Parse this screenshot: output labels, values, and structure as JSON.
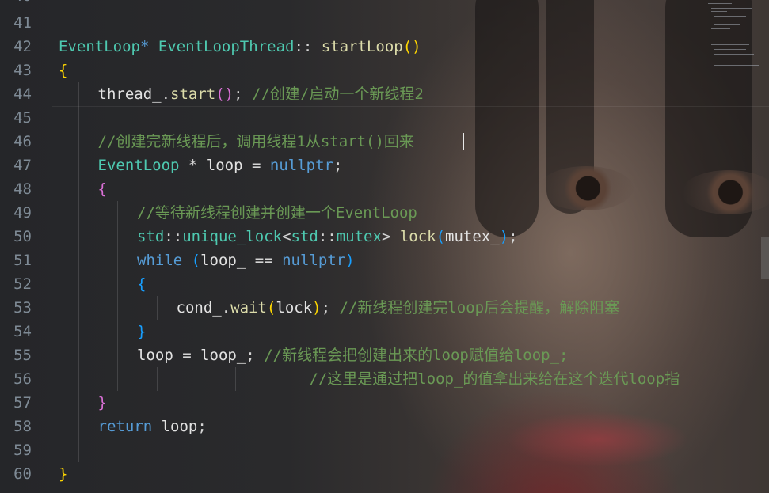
{
  "editor": {
    "first_line_partial": "40",
    "lines": [
      {
        "n": "41",
        "indent": 0,
        "tokens": []
      },
      {
        "n": "42",
        "indent": 0,
        "tokens": [
          [
            "type",
            "EventLoop"
          ],
          [
            "kw",
            "*"
          ],
          [
            "plain",
            " "
          ],
          [
            "type",
            "EventLoopThread"
          ],
          [
            "plain",
            ":: "
          ],
          [
            "fn",
            "startLoop"
          ],
          [
            "b1",
            "()"
          ]
        ]
      },
      {
        "n": "43",
        "indent": 0,
        "tokens": [
          [
            "b1",
            "{"
          ]
        ]
      },
      {
        "n": "44",
        "indent": 1,
        "tokens": [
          [
            "var",
            "thread_"
          ],
          [
            "plain",
            "."
          ],
          [
            "fn",
            "start"
          ],
          [
            "b2",
            "()"
          ],
          [
            "plain",
            "; "
          ],
          [
            "cmt",
            "//创建/启动一个新线程2"
          ]
        ]
      },
      {
        "n": "45",
        "indent": 0,
        "tokens": []
      },
      {
        "n": "46",
        "indent": 1,
        "tokens": [
          [
            "cmt",
            "//创建完新线程后，调用线程1从start()回来"
          ]
        ]
      },
      {
        "n": "47",
        "indent": 1,
        "tokens": [
          [
            "type",
            "EventLoop"
          ],
          [
            "plain",
            " * "
          ],
          [
            "var",
            "loop"
          ],
          [
            "plain",
            " = "
          ],
          [
            "kw",
            "nullptr"
          ],
          [
            "plain",
            ";"
          ]
        ]
      },
      {
        "n": "48",
        "indent": 1,
        "tokens": [
          [
            "b2",
            "{"
          ]
        ]
      },
      {
        "n": "49",
        "indent": 2,
        "tokens": [
          [
            "cmt",
            "//等待新线程创建并创建一个EventLoop"
          ]
        ]
      },
      {
        "n": "50",
        "indent": 2,
        "tokens": [
          [
            "type",
            "std"
          ],
          [
            "plain",
            "::"
          ],
          [
            "type",
            "unique_lock"
          ],
          [
            "plain",
            "<"
          ],
          [
            "type",
            "std"
          ],
          [
            "plain",
            "::"
          ],
          [
            "type",
            "mutex"
          ],
          [
            "plain",
            "> "
          ],
          [
            "fn",
            "lock"
          ],
          [
            "b3",
            "("
          ],
          [
            "var",
            "mutex_"
          ],
          [
            "b3",
            ")"
          ],
          [
            "plain",
            ";"
          ]
        ]
      },
      {
        "n": "51",
        "indent": 2,
        "tokens": [
          [
            "kw",
            "while"
          ],
          [
            "plain",
            " "
          ],
          [
            "b3",
            "("
          ],
          [
            "var",
            "loop_"
          ],
          [
            "plain",
            " == "
          ],
          [
            "kw",
            "nullptr"
          ],
          [
            "b3",
            ")"
          ]
        ]
      },
      {
        "n": "52",
        "indent": 2,
        "tokens": [
          [
            "b3",
            "{"
          ]
        ]
      },
      {
        "n": "53",
        "indent": 3,
        "tokens": [
          [
            "var",
            "cond_"
          ],
          [
            "plain",
            "."
          ],
          [
            "fn",
            "wait"
          ],
          [
            "b1",
            "("
          ],
          [
            "var",
            "lock"
          ],
          [
            "b1",
            ")"
          ],
          [
            "plain",
            "; "
          ],
          [
            "cmt",
            "//新线程创建完loop后会提醒，解除阻塞"
          ]
        ]
      },
      {
        "n": "54",
        "indent": 2,
        "tokens": [
          [
            "b3",
            "}"
          ]
        ]
      },
      {
        "n": "55",
        "indent": 2,
        "tokens": [
          [
            "var",
            "loop"
          ],
          [
            "plain",
            " = "
          ],
          [
            "var",
            "loop_"
          ],
          [
            "plain",
            "; "
          ],
          [
            "cmt",
            "//新线程会把创建出来的loop赋值给loop_;"
          ]
        ]
      },
      {
        "n": "56",
        "indent": 2,
        "tokens": [
          [
            "plain",
            "                   "
          ],
          [
            "cmt",
            "//这里是通过把loop_的值拿出来给在这个迭代loop指"
          ]
        ]
      },
      {
        "n": "57",
        "indent": 1,
        "tokens": [
          [
            "b2",
            "}"
          ]
        ]
      },
      {
        "n": "58",
        "indent": 1,
        "tokens": [
          [
            "kw",
            "return"
          ],
          [
            "plain",
            " "
          ],
          [
            "var",
            "loop"
          ],
          [
            "plain",
            ";"
          ]
        ]
      },
      {
        "n": "59",
        "indent": 0,
        "tokens": []
      },
      {
        "n": "60",
        "indent": 0,
        "tokens": [
          [
            "b1",
            "}"
          ]
        ]
      }
    ]
  },
  "colors": {
    "type": "#4ec9b0",
    "function": "#dcdcaa",
    "keyword": "#569cd6",
    "comment": "#6a9955",
    "bracket_level1": "#ffd700",
    "bracket_level2": "#da70d6",
    "bracket_level3": "#179fff",
    "line_number": "#7e8a95"
  }
}
